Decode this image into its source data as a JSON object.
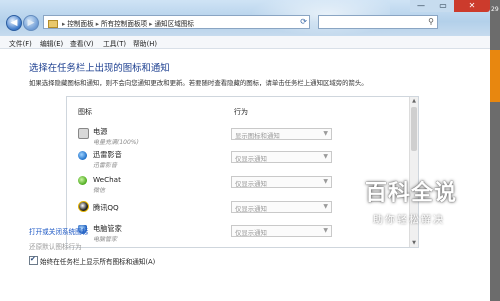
{
  "window": {
    "address": [
      "控制面板",
      "所有控制面板项",
      "通知区域图标"
    ],
    "controls": {
      "minimize": "—",
      "maximize": "▭",
      "close": "✕"
    }
  },
  "right_strip": {
    "time_fragment": "29"
  },
  "menu": [
    "文件(F)",
    "编辑(E)",
    "查看(V)",
    "工具(T)",
    "帮助(H)"
  ],
  "main": {
    "heading": "选择在任务栏上出现的图标和通知",
    "description": "如果选择隐藏图标和通知，则不会向您通知更改和更新。若要随时查看隐藏的图标，请单击任务栏上通知区域旁的箭头。",
    "columns": {
      "icon": "图标",
      "behavior": "行为"
    },
    "rows": [
      {
        "name": "电源",
        "sub": "电量充满(100%)",
        "behavior": "显示图标和通知"
      },
      {
        "name": "迅雷影音",
        "sub": "迅雷影音",
        "behavior": "仅显示通知"
      },
      {
        "name": "WeChat",
        "sub": "微信",
        "behavior": "仅显示通知"
      },
      {
        "name": "腾讯QQ",
        "sub": "",
        "behavior": "仅显示通知"
      },
      {
        "name": "电脑管家",
        "sub": "电脑管家",
        "behavior": "仅显示通知"
      }
    ],
    "link_system_icons": "打开或关闭系统图标",
    "link_restore": "还原默认图标行为",
    "always_show_label": "始终在任务栏上显示所有图标和通知(A)",
    "always_show_checked": true
  },
  "watermark": {
    "title": "百科全说",
    "subtitle": "助你轻松解决"
  },
  "colors": {
    "heading": "#1a3d8f",
    "link": "#1a56c4",
    "close": "#cc3b2c"
  }
}
